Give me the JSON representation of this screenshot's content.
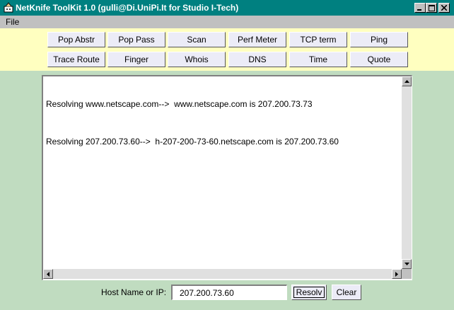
{
  "window": {
    "title": "NetKnife ToolKit 1.0 (gulli@Di.UniPi.It for Studio I-Tech)",
    "icons": [
      "app-icon",
      "minimize-icon",
      "maximize-icon",
      "close-icon"
    ]
  },
  "menu": {
    "file": "File"
  },
  "toolbar": {
    "row1": [
      "Pop Abstr",
      "Pop Pass",
      "Scan",
      "Perf Meter",
      "TCP term",
      "Ping"
    ],
    "row2": [
      "Trace Route",
      "Finger",
      "Whois",
      "DNS",
      "Time",
      "Quote"
    ]
  },
  "output": {
    "lines": [
      "Resolving www.netscape.com-->  www.netscape.com is 207.200.73.73",
      "Resolving 207.200.73.60-->  h-207-200-73-60.netscape.com is 207.200.73.60"
    ]
  },
  "host": {
    "label": "Host Name or IP:",
    "value": "207.200.73.60"
  },
  "buttons": {
    "resolve": "Resolv",
    "clear": "Clear"
  },
  "colors": {
    "titlebar": "#008080",
    "toolbar_bg": "#ffffc0",
    "content_bg": "#c0dcc0",
    "button_bg": "#ececf7"
  }
}
